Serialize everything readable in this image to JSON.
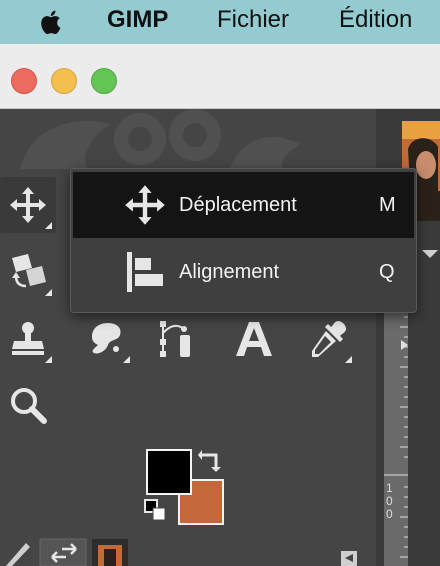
{
  "menubar": {
    "app_name": "GIMP",
    "menus": [
      "Fichier",
      "Édition"
    ]
  },
  "tool_menu": {
    "items": [
      {
        "label": "Déplacement",
        "shortcut": "M",
        "selected": true,
        "icon": "move-icon"
      },
      {
        "label": "Alignement",
        "shortcut": "Q",
        "selected": false,
        "icon": "align-icon"
      }
    ]
  },
  "tools": [
    "move-tool",
    "transform-tool",
    "clone-tool",
    "smudge-tool",
    "paths-tool",
    "text-tool",
    "color-picker-tool",
    "zoom-tool"
  ],
  "colors": {
    "foreground": "#000000",
    "background": "#c4673a"
  },
  "ruler": {
    "digits": [
      "1",
      "0",
      "0"
    ]
  }
}
